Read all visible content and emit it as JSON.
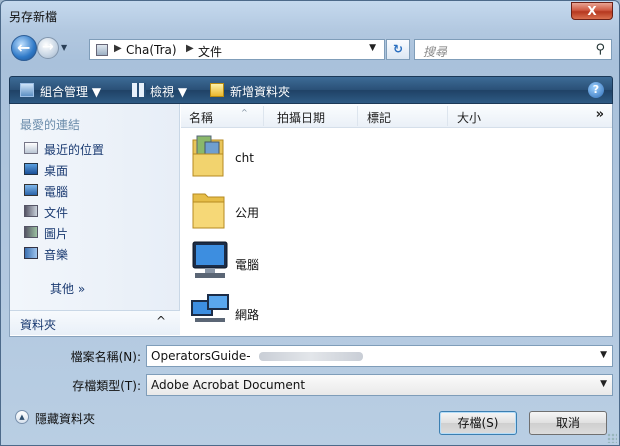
{
  "window": {
    "title": "另存新檔",
    "close_label": "X"
  },
  "address": {
    "crumbs": [
      "Cha(Tra)",
      "文件"
    ],
    "search_placeholder": "搜尋"
  },
  "toolbar": {
    "organize": "組合管理",
    "views": "檢視",
    "new_folder": "新增資料夾",
    "help": "?"
  },
  "nav_pane": {
    "favorites_header": "最愛的連結",
    "items": [
      {
        "label": "最近的位置",
        "icon": "recent-places-icon"
      },
      {
        "label": "桌面",
        "icon": "desktop-icon"
      },
      {
        "label": "電腦",
        "icon": "computer-icon"
      },
      {
        "label": "文件",
        "icon": "documents-icon"
      },
      {
        "label": "圖片",
        "icon": "pictures-icon"
      },
      {
        "label": "音樂",
        "icon": "music-icon"
      }
    ],
    "more": "其他 »",
    "folders": "資料夾",
    "folders_chevron": "^"
  },
  "columns": [
    "名稱",
    "拍攝日期",
    "標記",
    "大小"
  ],
  "columns_more": "»",
  "files": [
    {
      "name": "cht",
      "icon": "user-folder-icon"
    },
    {
      "name": "公用",
      "icon": "folder-icon"
    },
    {
      "name": "電腦",
      "icon": "computer-icon"
    },
    {
      "name": "網路",
      "icon": "network-icon"
    }
  ],
  "form": {
    "filename_label": "檔案名稱(N):",
    "filename_value": "OperatorsGuide-",
    "filetype_label": "存檔類型(T):",
    "filetype_value": "Adobe Acrobat Document"
  },
  "footer": {
    "hide_folders": "隱藏資料夾",
    "save": "存檔(S)",
    "cancel": "取消"
  },
  "colors": {
    "toolbar": "#2a5077",
    "link": "#1b3b72",
    "favorites_header": "#6b8cab"
  }
}
